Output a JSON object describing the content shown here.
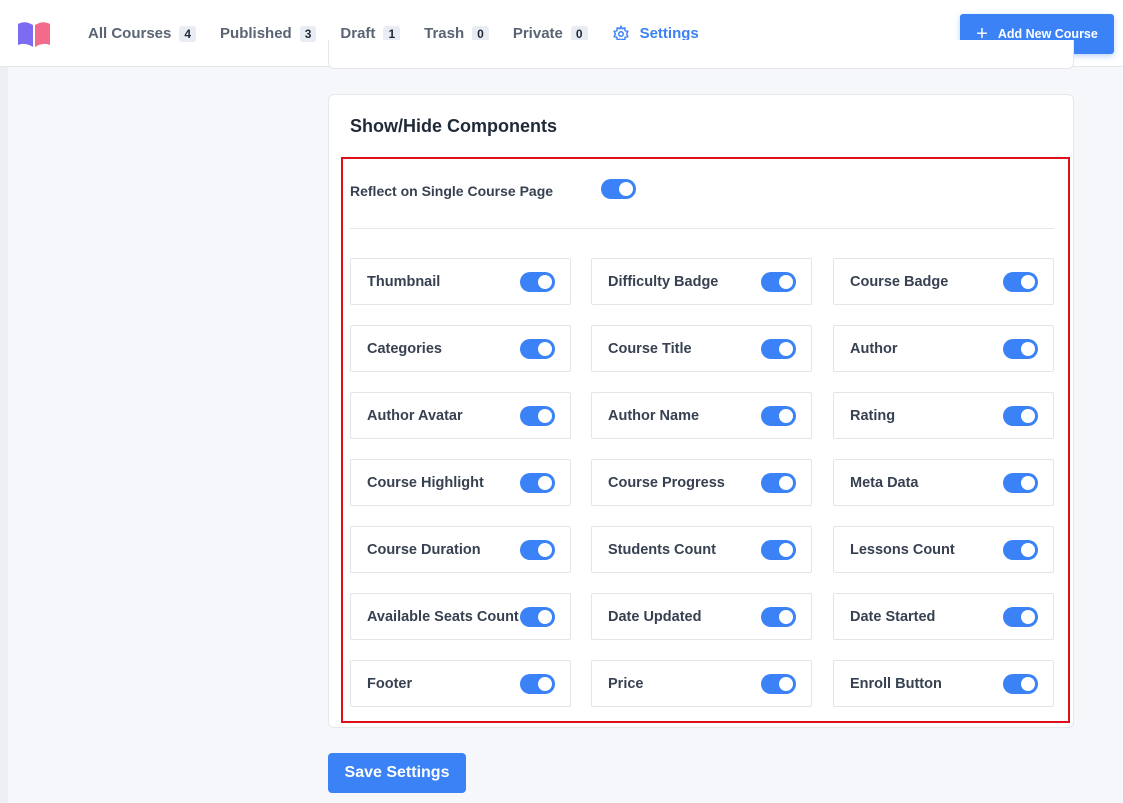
{
  "nav": {
    "tabs": [
      {
        "label": "All Courses",
        "count": "4"
      },
      {
        "label": "Published",
        "count": "3"
      },
      {
        "label": "Draft",
        "count": "1"
      },
      {
        "label": "Trash",
        "count": "0"
      },
      {
        "label": "Private",
        "count": "0"
      }
    ],
    "settings_label": "Settings",
    "add_button_label": "Add New Course"
  },
  "section": {
    "title": "Show/Hide Components",
    "reflect_label": "Reflect on Single Course Page",
    "reflect_enabled": true
  },
  "components": [
    {
      "label": "Thumbnail",
      "enabled": true
    },
    {
      "label": "Difficulty Badge",
      "enabled": true
    },
    {
      "label": "Course Badge",
      "enabled": true
    },
    {
      "label": "Categories",
      "enabled": true
    },
    {
      "label": "Course Title",
      "enabled": true
    },
    {
      "label": "Author",
      "enabled": true
    },
    {
      "label": "Author Avatar",
      "enabled": true
    },
    {
      "label": "Author Name",
      "enabled": true
    },
    {
      "label": "Rating",
      "enabled": true
    },
    {
      "label": "Course Highlight",
      "enabled": true
    },
    {
      "label": "Course Progress",
      "enabled": true
    },
    {
      "label": "Meta Data",
      "enabled": true
    },
    {
      "label": "Course Duration",
      "enabled": true
    },
    {
      "label": "Students Count",
      "enabled": true
    },
    {
      "label": "Lessons Count",
      "enabled": true
    },
    {
      "label": "Available Seats Count",
      "enabled": true
    },
    {
      "label": "Date Updated",
      "enabled": true
    },
    {
      "label": "Date Started",
      "enabled": true
    },
    {
      "label": "Footer",
      "enabled": true
    },
    {
      "label": "Price",
      "enabled": true
    },
    {
      "label": "Enroll Button",
      "enabled": true
    }
  ],
  "save_button_label": "Save Settings",
  "colors": {
    "accent": "#3b82f6",
    "highlight_border": "#e0101b"
  }
}
